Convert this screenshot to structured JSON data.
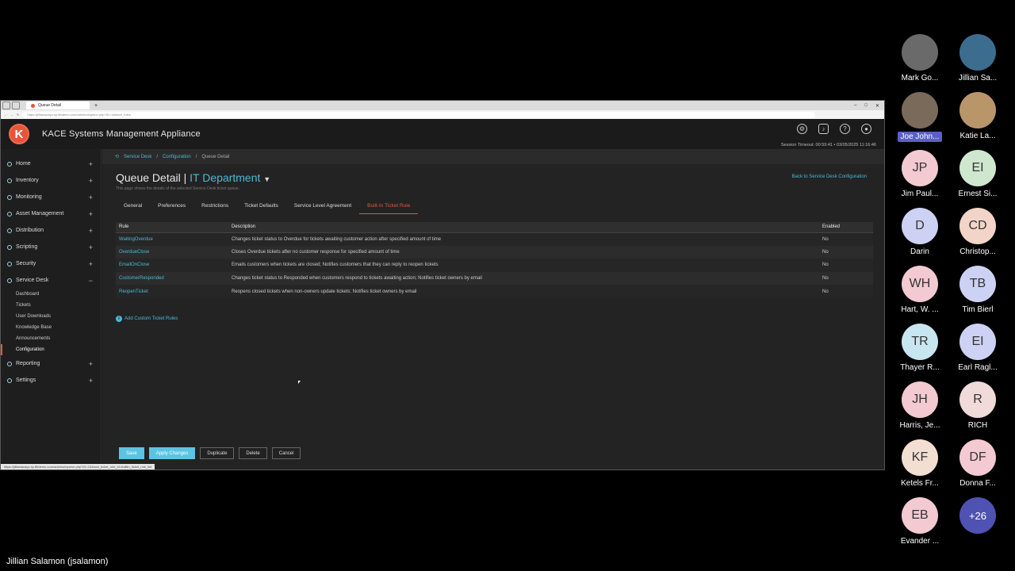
{
  "browser": {
    "tab_title": "Queue Detail",
    "url": "https://jillianiacayo.sp.ttbdemo.com/adminui/queue.php?ID=1#ticket_rules",
    "status_url": "https://jillianiacayo.sp.ttbdemo.com/adminui/queue.php?ID=1&block_ticket_rule_id=builtin_ticket_rule_list"
  },
  "app": {
    "title": "KACE Systems Management Appliance",
    "logo_letter": "K",
    "session": "Session Timeout: 00:59:41 • 03/05/2025 11:16:46"
  },
  "sidebar": {
    "items": [
      {
        "label": "Home",
        "toggle": "+"
      },
      {
        "label": "Inventory",
        "toggle": "+"
      },
      {
        "label": "Monitoring",
        "toggle": "+"
      },
      {
        "label": "Asset Management",
        "toggle": "+"
      },
      {
        "label": "Distribution",
        "toggle": "+"
      },
      {
        "label": "Scripting",
        "toggle": "+"
      },
      {
        "label": "Security",
        "toggle": "+"
      },
      {
        "label": "Service Desk",
        "toggle": "−"
      },
      {
        "label": "Reporting",
        "toggle": "+"
      },
      {
        "label": "Settings",
        "toggle": "+"
      }
    ],
    "service_desk_sub": [
      "Dashboard",
      "Tickets",
      "User Downloads",
      "Knowledge Base",
      "Announcements",
      "Configuration"
    ]
  },
  "breadcrumb": {
    "items": [
      "Service Desk",
      "Configuration",
      "Queue Detail"
    ],
    "separator": "/"
  },
  "page": {
    "title_prefix": "Queue Detail |",
    "department": "IT Department",
    "subtitle": "This page shows the details of the selected Service Desk ticket queue.",
    "back_link": "Back to Service Desk Configuration",
    "tabs": [
      "General",
      "Preferences",
      "Restrictions",
      "Ticket Defaults",
      "Service Level Agreement",
      "Built-In Ticket Rule"
    ],
    "active_tab": "Built-In Ticket Rule"
  },
  "rules_table": {
    "columns": [
      "Rule",
      "Description",
      "Enabled"
    ],
    "rows": [
      {
        "rule": "WaitingOverdue",
        "description": "Changes ticket status to Overdue for tickets awaiting customer action after specified amount of time",
        "enabled": "No"
      },
      {
        "rule": "OverdueClose",
        "description": "Closes Overdue tickets after no customer response for specified amount of time",
        "enabled": "No"
      },
      {
        "rule": "EmailOnClose",
        "description": "Emails customers when tickets are closed; Notifies customers that they can reply to reopen tickets",
        "enabled": "No"
      },
      {
        "rule": "CustomerResponded",
        "description": "Changes ticket status to Responded when customers respond to tickets awaiting action; Notifies ticket owners by email",
        "enabled": "No"
      },
      {
        "rule": "ReopenTicket",
        "description": "Reopens closed tickets when non-owners update tickets; Notifies ticket owners by email",
        "enabled": "No"
      }
    ]
  },
  "add_rules_label": "Add Custom Ticket Rules",
  "buttons": {
    "save": "Save",
    "apply": "Apply Changes",
    "duplicate": "Duplicate",
    "delete": "Delete",
    "cancel": "Cancel"
  },
  "participants": [
    {
      "initials": "",
      "name": "Mark Go...",
      "color": "#6a6a6a",
      "photo": true
    },
    {
      "initials": "",
      "name": "Jillian Sa...",
      "color": "#3c6d8f",
      "photo": true
    },
    {
      "initials": "",
      "name": "Joe John...",
      "color": "#7a6a5a",
      "photo": true,
      "highlight": true
    },
    {
      "initials": "",
      "name": "Katie La...",
      "color": "#b9956a",
      "photo": true
    },
    {
      "initials": "JP",
      "name": "Jim Paul...",
      "color": "#f3c9d2"
    },
    {
      "initials": "EI",
      "name": "Ernest Si...",
      "color": "#cfe7cf"
    },
    {
      "initials": "D",
      "name": "Darin",
      "color": "#cdd1f3"
    },
    {
      "initials": "CD",
      "name": "Christop...",
      "color": "#f3d4c8"
    },
    {
      "initials": "WH",
      "name": "Hart, W. ...",
      "color": "#f3c9d2"
    },
    {
      "initials": "TB",
      "name": "Tim Bierl",
      "color": "#cdd1f3"
    },
    {
      "initials": "TR",
      "name": "Thayer R...",
      "color": "#c8e6ef"
    },
    {
      "initials": "EI",
      "name": "Earl Ragl...",
      "color": "#cdd1f3"
    },
    {
      "initials": "JH",
      "name": "Harris, Je...",
      "color": "#f3c9d2"
    },
    {
      "initials": "R",
      "name": "RICH",
      "color": "#f0dada"
    },
    {
      "initials": "KF",
      "name": "Ketels Fr...",
      "color": "#f3dfd2"
    },
    {
      "initials": "DF",
      "name": "Donna F...",
      "color": "#f3c9d2"
    },
    {
      "initials": "EB",
      "name": "Evander ...",
      "color": "#f3c9d2"
    },
    {
      "initials": "+26",
      "name": "",
      "color": "#4f52b2"
    }
  ],
  "presenter": "Jillian Salamon (jsalamon)"
}
